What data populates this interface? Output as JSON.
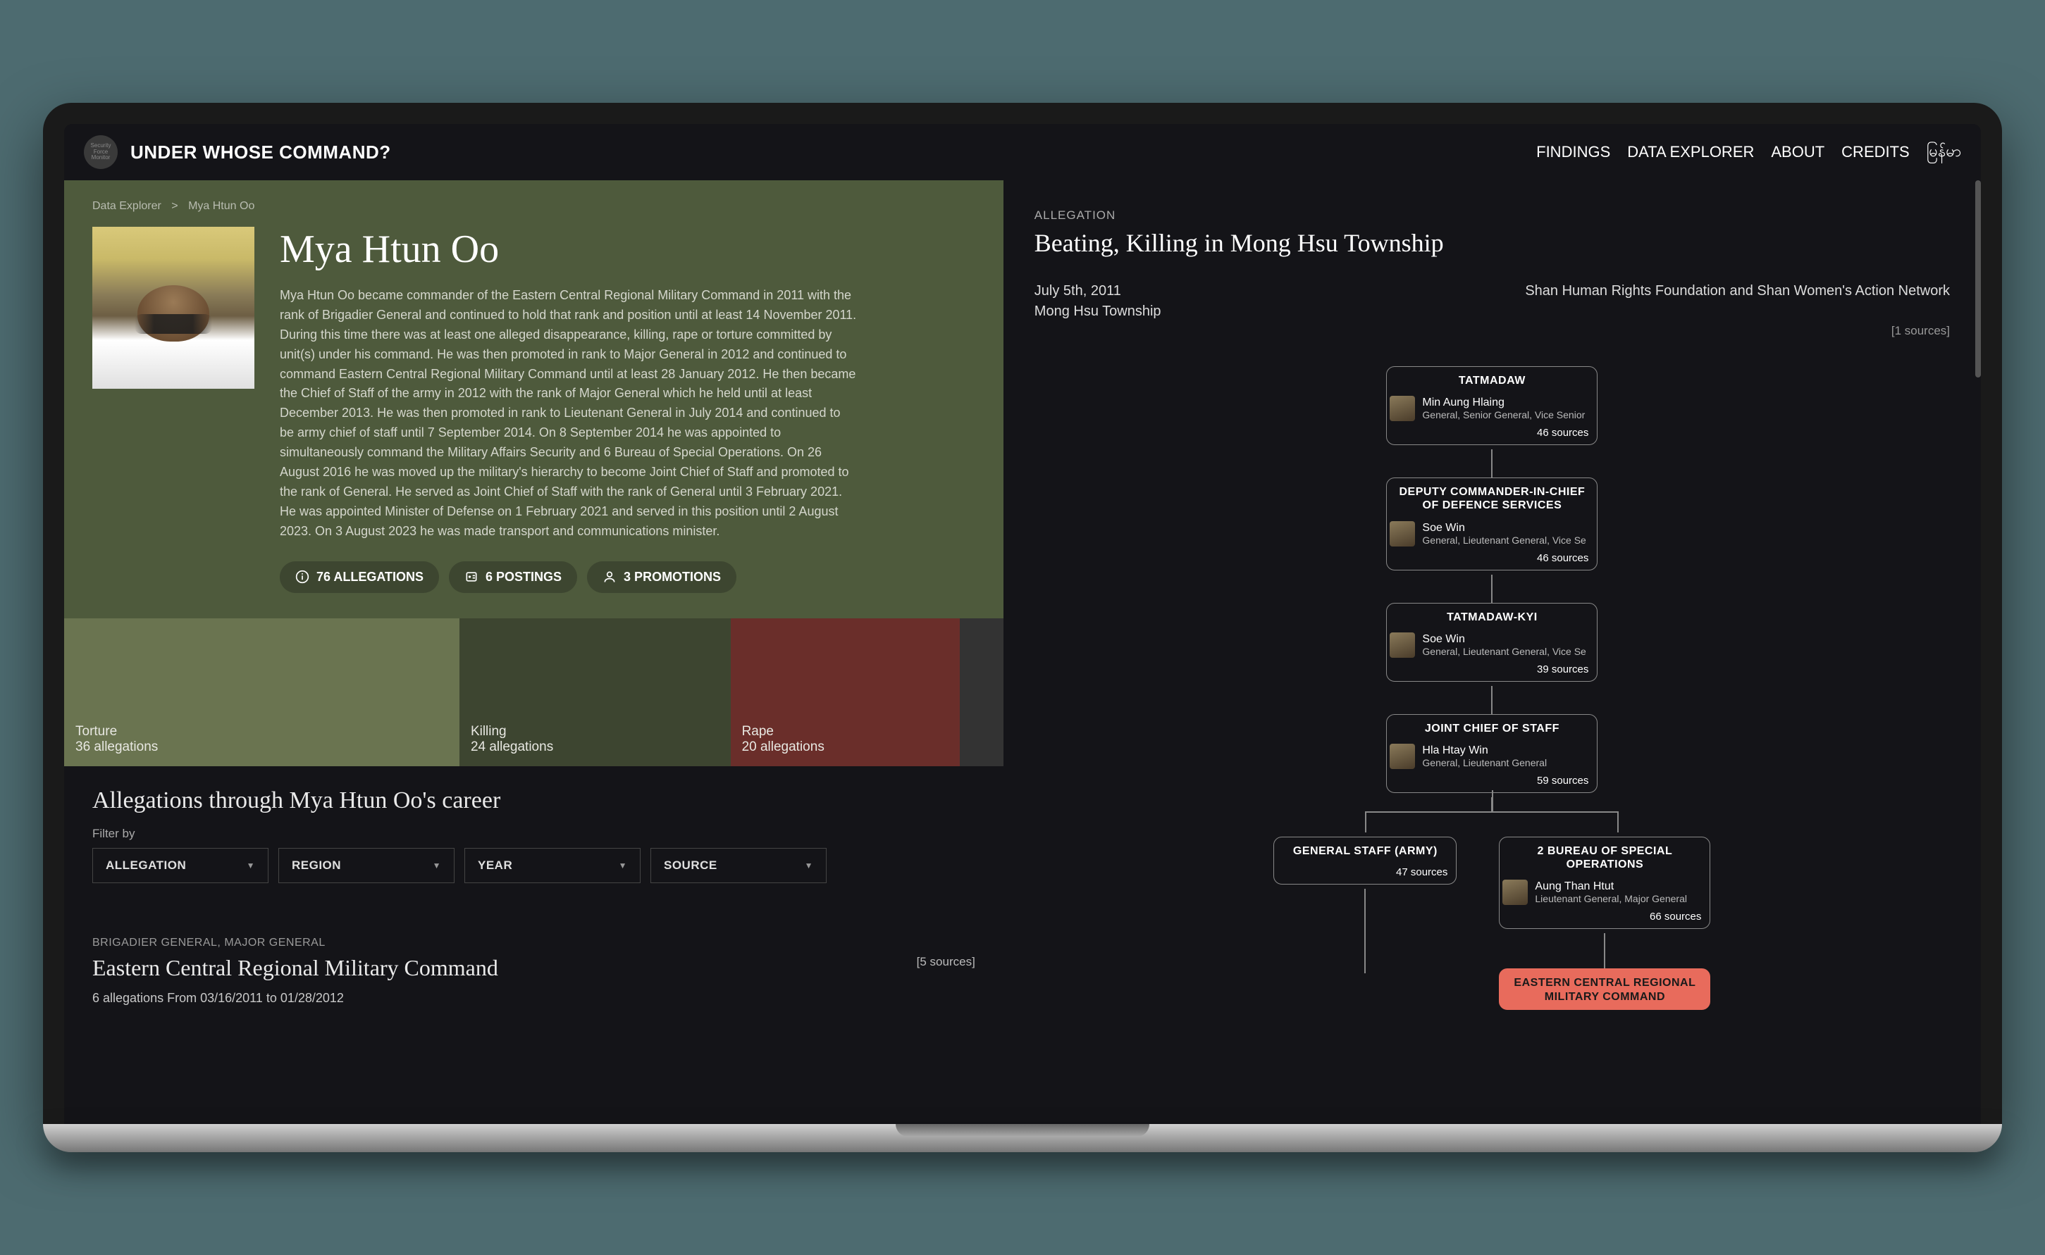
{
  "brand": {
    "logo_text": "Security Force Monitor",
    "title": "UNDER WHOSE COMMAND?"
  },
  "nav": {
    "findings": "FINDINGS",
    "data_explorer": "DATA EXPLORER",
    "about": "ABOUT",
    "credits": "CREDITS",
    "lang": "မြန်မာ"
  },
  "breadcrumb": {
    "root": "Data Explorer",
    "sep": ">",
    "current": "Mya Htun Oo"
  },
  "profile": {
    "name": "Mya Htun Oo",
    "description": "Mya Htun Oo became commander of the Eastern Central Regional Military Command in 2011 with the rank of Brigadier General and continued to hold that rank and position until at least 14 November 2011. During this time there was at least one alleged disappearance, killing, rape or torture committed by unit(s) under his command. He was then promoted in rank to Major General in 2012 and continued to command Eastern Central Regional Military Command until at least 28 January 2012. He then became the Chief of Staff of the army in 2012 with the rank of Major General which he held until at least December 2013. He was then promoted in rank to Lieutenant General in July 2014 and continued to be army chief of staff until 7 September 2014. On 8 September 2014 he was appointed to simultaneously command the Military Affairs Security and 6 Bureau of Special Operations. On 26 August 2016 he was moved up the military's hierarchy to become Joint Chief of Staff and promoted to the rank of General. He served as Joint Chief of Staff with the rank of General until 3 February 2021. He was appointed Minister of Defense on 1 February 2021 and served in this position until 2 August 2023. On 3 August 2023 he was made transport and communications minister.",
    "chips": {
      "allegations": "76 ALLEGATIONS",
      "postings": "6 POSTINGS",
      "promotions": "3 PROMOTIONS"
    }
  },
  "tiles": {
    "torture": {
      "label": "Torture",
      "count": "36 allegations"
    },
    "killing": {
      "label": "Killing",
      "count": "24 allegations"
    },
    "rape": {
      "label": "Rape",
      "count": "20 allegations"
    }
  },
  "career": {
    "heading": "Allegations through Mya Htun Oo's career",
    "filter_label": "Filter by",
    "filters": {
      "allegation": "ALLEGATION",
      "region": "REGION",
      "year": "YEAR",
      "source": "SOURCE"
    }
  },
  "group": {
    "rank": "BRIGADIER GENERAL, MAJOR GENERAL",
    "title": "Eastern Central Regional Military Command",
    "sources": "[5 sources]",
    "sub": "6 allegations From 03/16/2011 to 01/28/2012"
  },
  "right": {
    "label": "ALLEGATION",
    "title": "Beating, Killing in Mong Hsu Township",
    "date": "July 5th, 2011",
    "location": "Mong Hsu Township",
    "source_org": "Shan Human Rights Foundation and Shan Women's Action Network",
    "sources": "[1 sources]"
  },
  "tree": [
    {
      "title": "TATMADAW",
      "name": "Min Aung Hlaing",
      "rank": "General, Senior General, Vice Senior",
      "sources": "46 sources"
    },
    {
      "title": "DEPUTY COMMANDER-IN-CHIEF OF DEFENCE SERVICES",
      "name": "Soe Win",
      "rank": "General, Lieutenant General, Vice Se",
      "sources": "46 sources"
    },
    {
      "title": "TATMADAW-KYI",
      "name": "Soe Win",
      "rank": "General, Lieutenant General, Vice Se",
      "sources": "39 sources"
    },
    {
      "title": "JOINT CHIEF OF STAFF",
      "name": "Hla Htay Win",
      "rank": "General, Lieutenant General",
      "sources": "59 sources"
    }
  ],
  "branch_left": {
    "title": "GENERAL STAFF (ARMY)",
    "sources": "47 sources"
  },
  "branch_right": {
    "title": "2 BUREAU OF SPECIAL OPERATIONS",
    "name": "Aung Than Htut",
    "rank": "Lieutenant General, Major General",
    "sources": "66 sources"
  },
  "highlight": {
    "title": "EASTERN CENTRAL REGIONAL MILITARY COMMAND"
  }
}
